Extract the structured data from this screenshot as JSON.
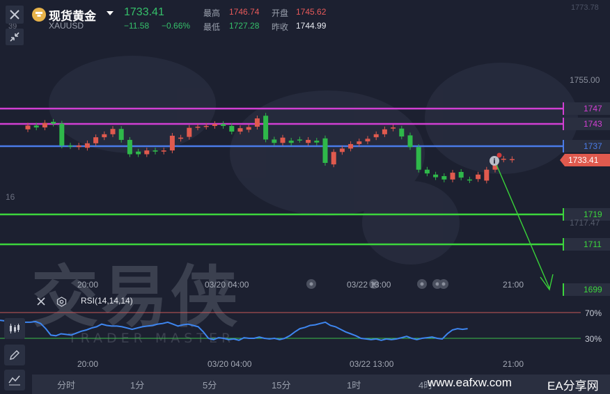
{
  "header": {
    "title": "现货黄金",
    "symbol": "XAUUSD",
    "price": "1733.41",
    "change": "−11.58",
    "change_pct": "−0.66%",
    "high_label": "最高",
    "high": "1746.74",
    "open_label": "开盘",
    "open": "1745.62",
    "low_label": "最低",
    "low": "1727.28",
    "prev_label": "昨收",
    "prev": "1744.99"
  },
  "axis": {
    "top_faint": "1773.78",
    "p1755": "1755.00",
    "p1717": "1717.47",
    "left_16": "16",
    "left_39": "39"
  },
  "levels": [
    {
      "label": "1747",
      "value": 1747,
      "color": "#d23fd3"
    },
    {
      "label": "1743",
      "value": 1743,
      "color": "#d23fd3"
    },
    {
      "label": "1737",
      "value": 1737,
      "color": "#4a7be8"
    },
    {
      "label": "1719",
      "value": 1719,
      "color": "#3cd63c"
    },
    {
      "label": "1711",
      "value": 1711,
      "color": "#3cd63c"
    },
    {
      "label": "1699",
      "value": 1699,
      "color": "#3cd63c"
    }
  ],
  "current_price_tag": "1733.41",
  "time_labels": [
    "20:00",
    "03/20 04:00",
    "03/22 13:00",
    "21:00"
  ],
  "rsi": {
    "label": "RSI(14,14,14)",
    "level_70": "70%",
    "level_30": "30%"
  },
  "timeframes": [
    "分时",
    "1分",
    "5分",
    "15分",
    "1时",
    "4时"
  ],
  "watermark": {
    "brand_cn": "交易侠",
    "brand_en": "TRADER MASTER"
  },
  "footer": {
    "site": "www.eafxw.com",
    "site_name": "EA分享网"
  },
  "chart_data": {
    "type": "candlestick",
    "symbol": "XAUUSD",
    "candles": [
      {
        "o": 1741.5,
        "c": 1742.5
      },
      {
        "o": 1742.5,
        "c": 1742.0
      },
      {
        "o": 1742.0,
        "c": 1743.2
      },
      {
        "o": 1743.5,
        "c": 1743.0
      },
      {
        "o": 1743.0,
        "c": 1737.2
      },
      {
        "o": 1737.2,
        "c": 1737.0
      },
      {
        "o": 1736.8,
        "c": 1737.2
      },
      {
        "o": 1736.6,
        "c": 1737.8
      },
      {
        "o": 1737.8,
        "c": 1739.4
      },
      {
        "o": 1739.4,
        "c": 1740.2
      },
      {
        "o": 1740.2,
        "c": 1741.6
      },
      {
        "o": 1741.6,
        "c": 1738.7
      },
      {
        "o": 1738.7,
        "c": 1734.9
      },
      {
        "o": 1735.6,
        "c": 1734.9
      },
      {
        "o": 1734.9,
        "c": 1735.9
      },
      {
        "o": 1735.9,
        "c": 1735.6
      },
      {
        "o": 1735.6,
        "c": 1735.9
      },
      {
        "o": 1735.9,
        "c": 1739.8
      },
      {
        "o": 1739.0,
        "c": 1739.3
      },
      {
        "o": 1739.5,
        "c": 1741.9
      },
      {
        "o": 1742.0,
        "c": 1742.2
      },
      {
        "o": 1742.2,
        "c": 1742.4
      },
      {
        "o": 1742.4,
        "c": 1742.9
      },
      {
        "o": 1742.9,
        "c": 1742.4
      },
      {
        "o": 1742.4,
        "c": 1740.9
      },
      {
        "o": 1740.9,
        "c": 1741.8
      },
      {
        "o": 1741.4,
        "c": 1742.1
      },
      {
        "o": 1742.2,
        "c": 1744.4
      },
      {
        "o": 1745.1,
        "c": 1738.8
      },
      {
        "o": 1738.8,
        "c": 1737.9
      },
      {
        "o": 1737.9,
        "c": 1739.3
      },
      {
        "o": 1738.5,
        "c": 1737.9
      },
      {
        "o": 1738.8,
        "c": 1738.7
      },
      {
        "o": 1737.9,
        "c": 1738.7
      },
      {
        "o": 1738.5,
        "c": 1738.0
      },
      {
        "o": 1739.1,
        "c": 1732.6
      },
      {
        "o": 1732.2,
        "c": 1735.5
      },
      {
        "o": 1735.5,
        "c": 1736.4
      },
      {
        "o": 1736.4,
        "c": 1737.6
      },
      {
        "o": 1737.6,
        "c": 1738.3
      },
      {
        "o": 1738.3,
        "c": 1739.0
      },
      {
        "o": 1739.4,
        "c": 1740.2
      },
      {
        "o": 1740.2,
        "c": 1741.5
      },
      {
        "o": 1741.7,
        "c": 1742.0
      },
      {
        "o": 1741.7,
        "c": 1739.6
      },
      {
        "o": 1739.9,
        "c": 1736.8
      },
      {
        "o": 1736.8,
        "c": 1730.8
      },
      {
        "o": 1730.8,
        "c": 1729.8
      },
      {
        "o": 1729.5,
        "c": 1728.8
      },
      {
        "o": 1729.1,
        "c": 1728.2
      },
      {
        "o": 1728.2,
        "c": 1730.0
      },
      {
        "o": 1730.2,
        "c": 1728.7
      },
      {
        "o": 1728.2,
        "c": 1728.0
      },
      {
        "o": 1728.3,
        "c": 1729.5
      },
      {
        "o": 1727.9,
        "c": 1730.8
      },
      {
        "o": 1730.8,
        "c": 1733.1
      },
      {
        "o": 1733.5,
        "c": 1733.7
      },
      {
        "o": 1733.4,
        "c": 1733.6
      }
    ],
    "levels": [
      1747,
      1743,
      1737,
      1719,
      1711,
      1699
    ],
    "last_price": 1733.41,
    "time_labels": [
      "20:00",
      "03/20 04:00",
      "03/22 13:00",
      "21:00"
    ],
    "rsi_levels": [
      70,
      30
    ],
    "rsi_values": [
      58,
      57,
      55,
      56,
      54,
      55,
      55,
      56,
      53,
      45,
      35,
      34,
      37,
      36,
      35,
      38,
      41,
      43,
      46,
      48,
      52,
      50,
      49,
      49,
      48,
      46,
      44,
      46,
      48,
      49,
      50,
      52,
      53,
      55,
      52,
      49,
      51,
      52,
      50,
      48,
      40,
      30,
      28,
      31,
      30,
      28,
      29,
      27,
      31,
      30,
      30,
      32,
      30,
      29,
      30,
      28,
      30,
      34,
      40,
      45,
      47,
      50,
      51,
      53,
      55,
      50,
      48,
      44,
      40,
      37,
      34,
      30,
      29,
      28,
      29,
      27,
      29,
      28,
      29,
      31,
      33,
      30,
      28,
      30,
      31,
      32,
      30,
      29,
      37,
      43,
      45,
      44,
      45
    ],
    "ylim": [
      1695,
      1775
    ]
  }
}
